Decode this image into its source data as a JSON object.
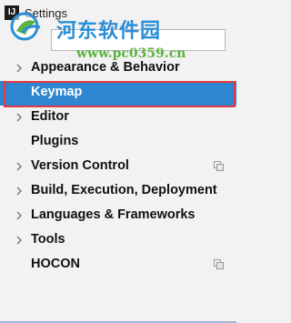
{
  "window": {
    "app_icon_text": "IJ",
    "title": "Settings",
    "icon": "intellij-icon"
  },
  "watermark": {
    "name": "河东软件园",
    "url": "www.pc0359.cn",
    "logo_icon": "watermark-logo-icon",
    "colors": {
      "name": "#2a8fd6",
      "url": "#5bb341"
    }
  },
  "search": {
    "value": "",
    "placeholder": ""
  },
  "tree": {
    "items": [
      {
        "label": "Appearance & Behavior",
        "expandable": true,
        "selected": false,
        "has_copy_icon": false
      },
      {
        "label": "Keymap",
        "expandable": false,
        "selected": true,
        "has_copy_icon": false
      },
      {
        "label": "Editor",
        "expandable": true,
        "selected": false,
        "has_copy_icon": false
      },
      {
        "label": "Plugins",
        "expandable": false,
        "selected": false,
        "has_copy_icon": false
      },
      {
        "label": "Version Control",
        "expandable": true,
        "selected": false,
        "has_copy_icon": true
      },
      {
        "label": "Build, Execution, Deployment",
        "expandable": true,
        "selected": false,
        "has_copy_icon": false
      },
      {
        "label": "Languages & Frameworks",
        "expandable": true,
        "selected": false,
        "has_copy_icon": false
      },
      {
        "label": "Tools",
        "expandable": true,
        "selected": false,
        "has_copy_icon": false
      },
      {
        "label": "HOCON",
        "expandable": false,
        "selected": false,
        "has_copy_icon": true
      }
    ]
  },
  "colors": {
    "selection_bg": "#2e86d1",
    "highlight_outline": "#e5373f",
    "background": "#f2f2f2"
  }
}
